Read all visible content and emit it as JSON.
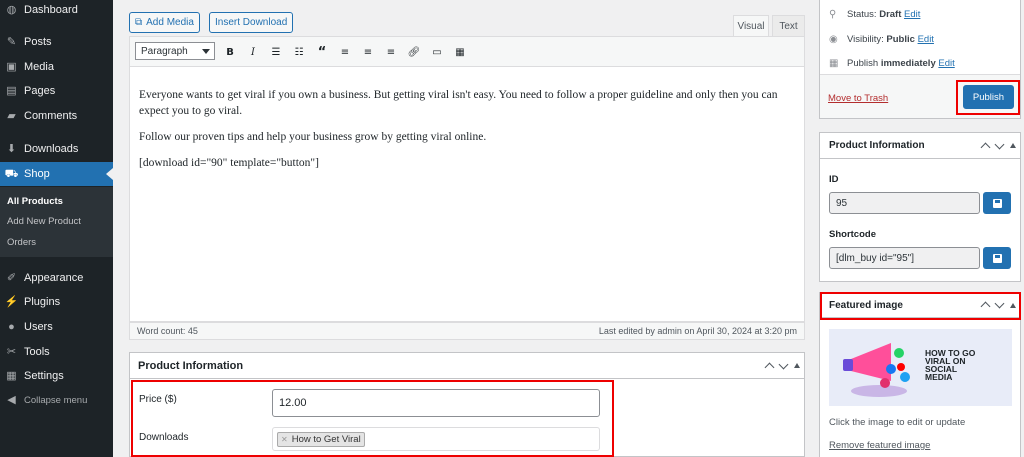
{
  "sidebar": {
    "items": [
      {
        "label": "Dashboard",
        "icon": "dashboard-icon",
        "glyph": "◍"
      },
      {
        "label": "Posts",
        "icon": "pin-icon",
        "glyph": "✎"
      },
      {
        "label": "Media",
        "icon": "media-icon",
        "glyph": "▣"
      },
      {
        "label": "Pages",
        "icon": "pages-icon",
        "glyph": "▤"
      },
      {
        "label": "Comments",
        "icon": "comments-icon",
        "glyph": "▰"
      },
      {
        "label": "Downloads",
        "icon": "download-icon",
        "glyph": "⬇"
      },
      {
        "label": "Shop",
        "icon": "cart-icon",
        "glyph": "⛟"
      },
      {
        "label": "Appearance",
        "icon": "brush-icon",
        "glyph": "✐"
      },
      {
        "label": "Plugins",
        "icon": "plugin-icon",
        "glyph": "⚡"
      },
      {
        "label": "Users",
        "icon": "users-icon",
        "glyph": "●"
      },
      {
        "label": "Tools",
        "icon": "wrench-icon",
        "glyph": "✂"
      },
      {
        "label": "Settings",
        "icon": "settings-icon",
        "glyph": "▦"
      }
    ],
    "submenu": [
      "All Products",
      "Add New Product",
      "Orders"
    ],
    "collapse": "Collapse menu"
  },
  "editor": {
    "add_media": "Add Media",
    "insert_download": "Insert Download",
    "tab_visual": "Visual",
    "tab_text": "Text",
    "format": "Paragraph",
    "paragraphs": [
      "Everyone wants to get viral if you own a business. But getting viral isn't easy. You need to follow a proper guideline and only then you can expect you to go viral.",
      "Follow our proven tips and help your business grow by getting viral online.",
      "[download id=\"90\" template=\"button\"]"
    ],
    "word_count": "Word count: 45",
    "last_edited": "Last edited by admin on April 30, 2024 at 3:20 pm"
  },
  "product_info": {
    "title": "Product Information",
    "price_label": "Price ($)",
    "price_value": "12.00",
    "downloads_label": "Downloads",
    "download_tag": "How to Get Viral"
  },
  "publish": {
    "status_label": "Status:",
    "status_value": "Draft",
    "visibility_label": "Visibility:",
    "visibility_value": "Public",
    "publish_label": "Publish",
    "publish_value": "immediately",
    "edit": "Edit",
    "trash": "Move to Trash",
    "publish_button": "Publish"
  },
  "side_product_info": {
    "title": "Product Information",
    "id_label": "ID",
    "id_value": "95",
    "shortcode_label": "Shortcode",
    "shortcode_value": "[dlm_buy id=\"95\"]"
  },
  "featured": {
    "title": "Featured image",
    "image_text": "HOW TO GO VIRAL ON SOCIAL MEDIA",
    "caption": "Click the image to edit or update",
    "remove": "Remove featured image"
  },
  "colors": {
    "accent": "#2271b1",
    "highlight": "#e00000",
    "sidebar": "#1d2327"
  }
}
